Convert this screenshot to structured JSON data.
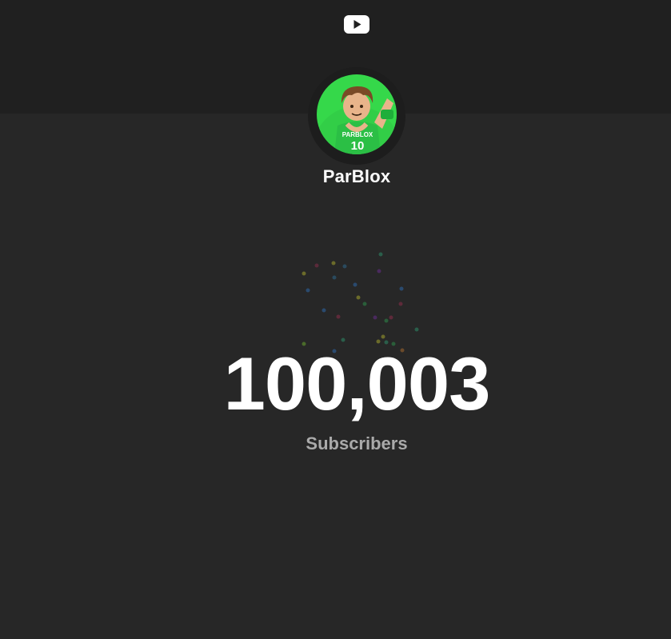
{
  "channel": {
    "name": "ParBlox",
    "avatar": {
      "jersey_text": "PARBLOX",
      "jersey_number": "10",
      "background_color": "#35d84a"
    }
  },
  "counter": {
    "value": "100,003",
    "label": "Subscribers"
  },
  "icons": {
    "platform": "youtube-play-icon"
  },
  "colors": {
    "page_background": "#272727",
    "header_background": "#202020",
    "text_primary": "#ffffff",
    "text_secondary": "#aaaaaa"
  }
}
